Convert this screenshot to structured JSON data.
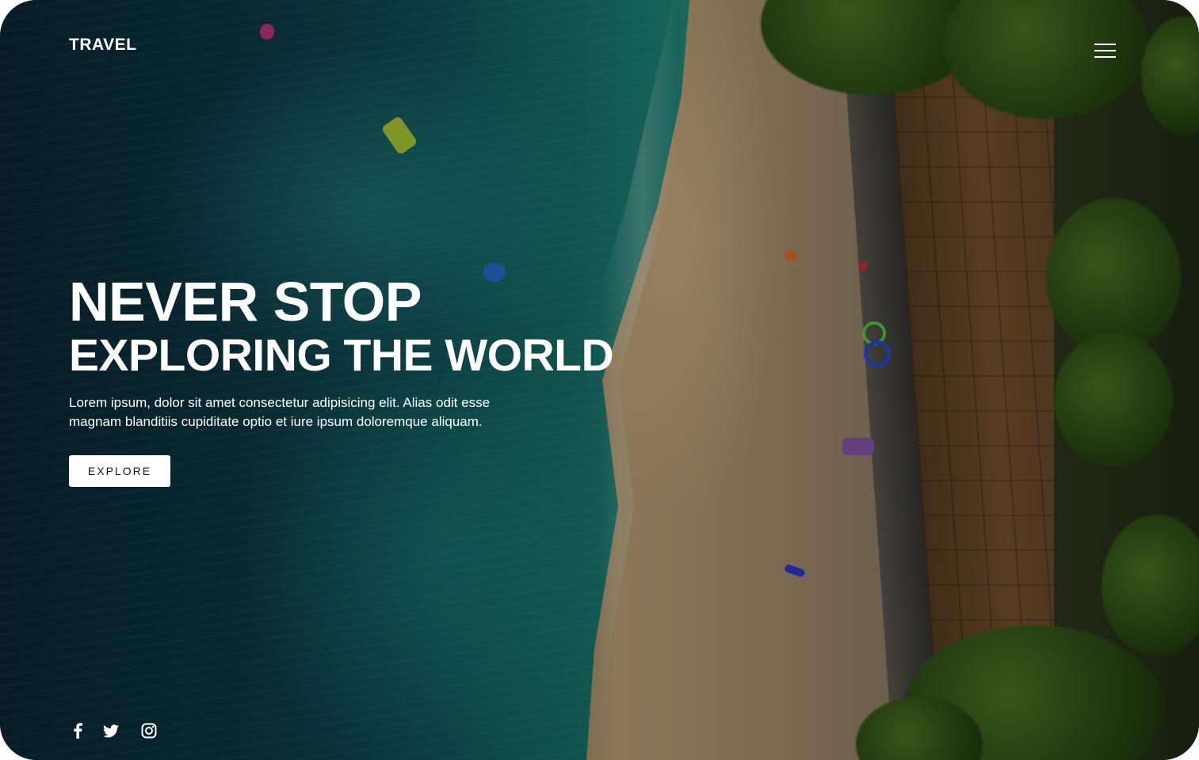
{
  "header": {
    "logo": "TRAVEL",
    "menu_icon": "hamburger-menu-icon"
  },
  "hero": {
    "title_line_1": "NEVER STOP",
    "title_line_2": "EXPLORING THE WORLD",
    "description": "Lorem ipsum, dolor sit amet consectetur adipisicing elit. Alias odit esse magnam blanditiis cupiditate optio et iure ipsum doloremque aliquam.",
    "cta_label": "EXPLORE"
  },
  "social": {
    "icons": [
      "facebook-icon",
      "twitter-icon",
      "instagram-icon"
    ]
  },
  "colors": {
    "text": "#ffffff",
    "button_bg": "#ffffff",
    "button_text": "#1a1a1a"
  }
}
